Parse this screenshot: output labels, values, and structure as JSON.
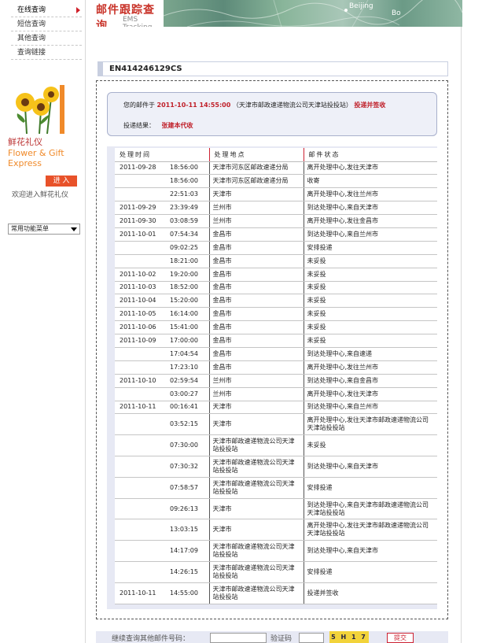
{
  "sidebar": {
    "nav": [
      {
        "label": "在线查询",
        "active": true
      },
      {
        "label": "短信查询",
        "active": false
      },
      {
        "label": "其他查询",
        "active": false
      },
      {
        "label": "查询链接",
        "active": false
      }
    ],
    "promo_title": "鲜花礼仪",
    "promo_en_1": "Flower & Gift",
    "promo_en_2": "Express",
    "enter_label": "进 入",
    "welcome": "欢迎进入鲜花礼仪",
    "common_select": "常用功能菜单"
  },
  "banner": {
    "title": "邮件跟踪查询",
    "subtitle": "EMS Tracking",
    "cities": [
      "Beijing",
      "Bo"
    ]
  },
  "tracking_number": "EN414246129CS",
  "summary": {
    "prefix": "您的邮件于",
    "date": "2011-10-11 14:55:00",
    "location_text": "（天津市邮政速递物流公司天津站投投站）",
    "status": "投递并签收",
    "result_label": "投递结果：",
    "result_value": "张建本代收"
  },
  "table": {
    "headers": [
      "处理时间",
      "处理地点",
      "邮件状态"
    ],
    "rows": [
      {
        "date": "2011-09-28",
        "time": "18:56:00",
        "location": "天津市河东区邮政速递分局",
        "status": "离开处理中心,发往天津市"
      },
      {
        "date": "",
        "time": "18:56:00",
        "location": "天津市河东区邮政速递分局",
        "status": "收寄"
      },
      {
        "date": "",
        "time": "22:51:03",
        "location": "天津市",
        "status": "离开处理中心,发往兰州市"
      },
      {
        "date": "2011-09-29",
        "time": "23:39:49",
        "location": "兰州市",
        "status": "到达处理中心,来自天津市"
      },
      {
        "date": "2011-09-30",
        "time": "03:08:59",
        "location": "兰州市",
        "status": "离开处理中心,发往金昌市"
      },
      {
        "date": "2011-10-01",
        "time": "07:54:34",
        "location": "金昌市",
        "status": "到达处理中心,来自兰州市"
      },
      {
        "date": "",
        "time": "09:02:25",
        "location": "金昌市",
        "status": "安排投递"
      },
      {
        "date": "",
        "time": "18:21:00",
        "location": "金昌市",
        "status": "未妥投"
      },
      {
        "date": "2011-10-02",
        "time": "19:20:00",
        "location": "金昌市",
        "status": "未妥投"
      },
      {
        "date": "2011-10-03",
        "time": "18:52:00",
        "location": "金昌市",
        "status": "未妥投"
      },
      {
        "date": "2011-10-04",
        "time": "15:20:00",
        "location": "金昌市",
        "status": "未妥投"
      },
      {
        "date": "2011-10-05",
        "time": "16:14:00",
        "location": "金昌市",
        "status": "未妥投"
      },
      {
        "date": "2011-10-06",
        "time": "15:41:00",
        "location": "金昌市",
        "status": "未妥投"
      },
      {
        "date": "2011-10-09",
        "time": "17:00:00",
        "location": "金昌市",
        "status": "未妥投"
      },
      {
        "date": "",
        "time": "17:04:54",
        "location": "金昌市",
        "status": "到达处理中心,来自速递"
      },
      {
        "date": "",
        "time": "17:23:10",
        "location": "金昌市",
        "status": "离开处理中心,发往兰州市"
      },
      {
        "date": "2011-10-10",
        "time": "02:59:54",
        "location": "兰州市",
        "status": "到达处理中心,来自金昌市"
      },
      {
        "date": "",
        "time": "03:00:27",
        "location": "兰州市",
        "status": "离开处理中心,发往天津市"
      },
      {
        "date": "2011-10-11",
        "time": "00:16:41",
        "location": "天津市",
        "status": "到达处理中心,来自兰州市"
      },
      {
        "date": "",
        "time": "03:52:15",
        "location": "天津市",
        "status": "离开处理中心,发往天津市邮政速递物流公司天津站投投站"
      },
      {
        "date": "",
        "time": "07:30:00",
        "location": "天津市邮政速递物流公司天津站投投站",
        "status": "未妥投"
      },
      {
        "date": "",
        "time": "07:30:32",
        "location": "天津市邮政速递物流公司天津站投投站",
        "status": "到达处理中心,来自天津市"
      },
      {
        "date": "",
        "time": "07:58:57",
        "location": "天津市邮政速递物流公司天津站投投站",
        "status": "安排投递"
      },
      {
        "date": "",
        "time": "09:26:13",
        "location": "天津市",
        "status": "到达处理中心,来自天津市邮政速递物流公司天津站投投站"
      },
      {
        "date": "",
        "time": "13:03:15",
        "location": "天津市",
        "status": "离开处理中心,发往天津市邮政速递物流公司天津站投投站"
      },
      {
        "date": "",
        "time": "14:17:09",
        "location": "天津市邮政速递物流公司天津站投投站",
        "status": "到达处理中心,来自天津市"
      },
      {
        "date": "",
        "time": "14:26:15",
        "location": "天津市邮政速递物流公司天津站投投站",
        "status": "安排投递"
      },
      {
        "date": "2011-10-11",
        "time": "14:55:00",
        "location": "天津市邮政速递物流公司天津站投投站",
        "status": "投递并签收"
      }
    ]
  },
  "bottom": {
    "query_label": "继续查询其他邮件号码：",
    "captcha_label": "验证码",
    "captcha_text": "5 H 1 7",
    "submit_label": "提交"
  }
}
